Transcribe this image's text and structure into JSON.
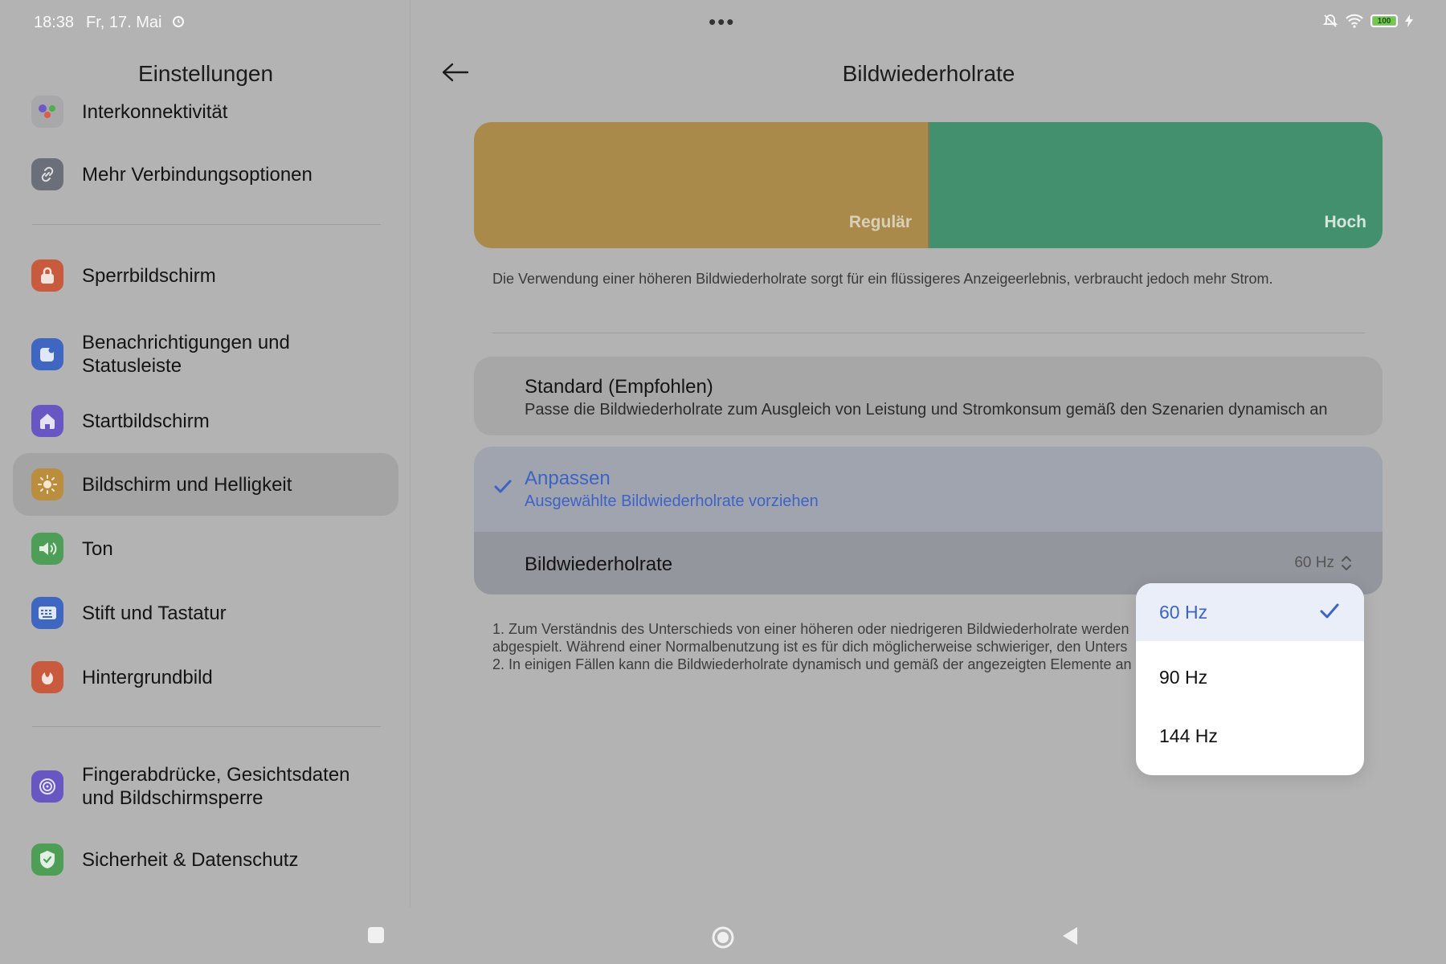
{
  "status": {
    "time": "18:38",
    "date": "Fr, 17. Mai",
    "battery": "100",
    "battery_level": 1.0
  },
  "sidebar": {
    "title": "Einstellungen",
    "items": [
      {
        "label": "Interkonnektivität",
        "icon": "interconnect-icon"
      },
      {
        "label": "Mehr Verbindungsoptionen",
        "icon": "link-icon"
      },
      {
        "label": "Sperrbildschirm",
        "icon": "lock-icon"
      },
      {
        "label": "Benachrichtigungen und Statusleiste",
        "icon": "notification-icon"
      },
      {
        "label": "Startbildschirm",
        "icon": "home-icon"
      },
      {
        "label": "Bildschirm und Helligkeit",
        "icon": "brightness-icon"
      },
      {
        "label": "Ton",
        "icon": "speaker-icon"
      },
      {
        "label": "Stift und Tastatur",
        "icon": "keyboard-icon"
      },
      {
        "label": "Hintergrundbild",
        "icon": "wallpaper-icon"
      },
      {
        "label": "Fingerabdrücke, Gesichtsdaten und Bildschirmsperre",
        "icon": "fingerprint-icon"
      },
      {
        "label": "Sicherheit & Datenschutz",
        "icon": "shield-icon"
      }
    ]
  },
  "page": {
    "title": "Bildwiederholrate",
    "preview": {
      "regular": "Regulär",
      "high": "Hoch"
    },
    "description": "Die Verwendung einer höheren Bildwiederholrate sorgt für ein flüssigeres Anzeigeerlebnis, verbraucht jedoch mehr Strom.",
    "options": [
      {
        "title": "Standard (Empfohlen)",
        "subtitle": "Passe die Bildwiederholrate zum Ausgleich von Leistung und Stromkonsum gemäß den Szenarien dynamisch an"
      },
      {
        "title": "Anpassen",
        "subtitle": "Ausgewählte Bildwiederholrate vorziehen",
        "selected": true
      }
    ],
    "rate_label": "Bildwiederholrate",
    "rate_value": "60 Hz",
    "notes": [
      "1. Zum Verständnis des Unterschieds von einer höheren oder niedrigeren Bildwiederholrate werden",
      "abgespielt. Während einer Normalbenutzung ist es für dich möglicherweise schwieriger, den Unters",
      "2. In einigen Fällen kann die Bildwiederholrate dynamisch und gemäß der angezeigten Elemente an"
    ]
  },
  "dropdown": {
    "options": [
      "60 Hz",
      "90 Hz",
      "144 Hz"
    ],
    "selected": "60 Hz"
  },
  "colors": {
    "accent": "#3d63c7",
    "regular": "#aa8a4b",
    "high": "#42906e"
  }
}
